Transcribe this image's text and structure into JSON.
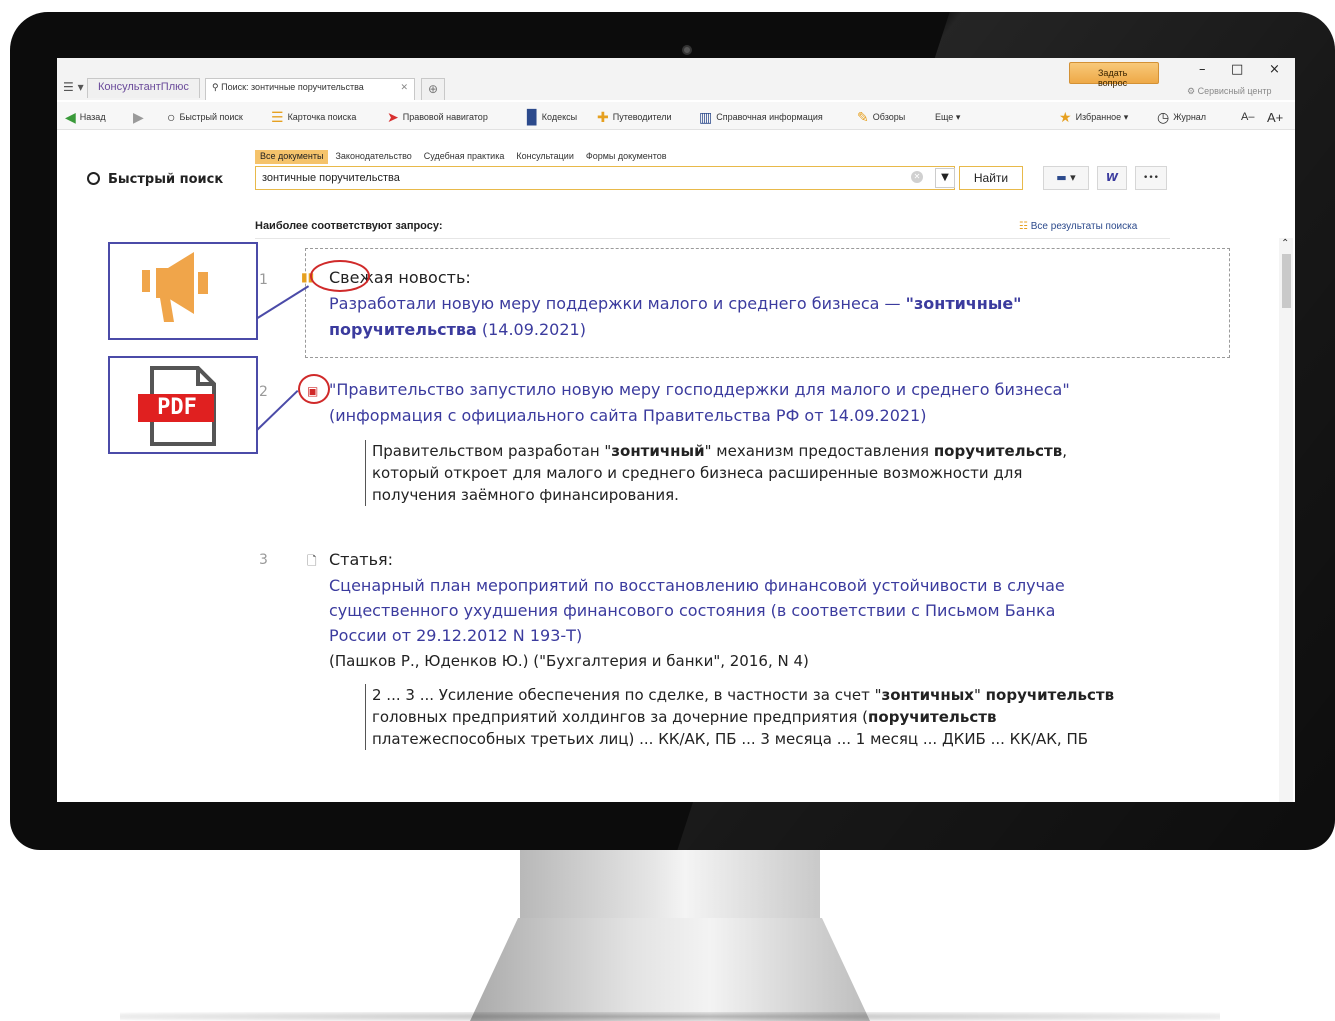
{
  "app": {
    "app_tab": "КонсультантПлюс",
    "search_tab": "Поиск: зонтичные поручительства",
    "ask_button": "Задать вопрос",
    "service_center": "Сервисный центр",
    "window_controls": {
      "minimize": "–",
      "maximize": "□",
      "close": "×"
    }
  },
  "toolbar": {
    "back": "Назад",
    "quick_search": "Быстрый поиск",
    "search_card": "Карточка поиска",
    "legal_navigator": "Правовой навигатор",
    "codes": "Кодексы",
    "guides": "Путеводители",
    "reference": "Справочная информация",
    "reviews": "Обзоры",
    "more": "Еще",
    "favorites": "Избранное",
    "journal": "Журнал",
    "font_small": "A–",
    "font_large": "A+"
  },
  "search": {
    "title": "Быстрый поиск",
    "filters": [
      "Все документы",
      "Законодательство",
      "Судебная практика",
      "Консультации",
      "Формы документов"
    ],
    "active_filter": 0,
    "query": "зонтичные поручительства",
    "find_button": "Найти",
    "word_button": "W",
    "more_button": "•••"
  },
  "results": {
    "header": "Наиболее соответствуют запросу:",
    "all_results": "Все результаты поиска",
    "items": [
      {
        "num": "1",
        "label": "Свежая новость:",
        "link_a": "Разработали новую меру поддержки малого и среднего бизнеса — ",
        "link_b": "\"зонтичные\"",
        "link_c": "поручительства",
        "link_d": " (14.09.2021)"
      },
      {
        "num": "2",
        "title_line1": "\"Правительство запустило новую меру господдержки для малого и среднего бизнеса\"",
        "title_line2": "(информация с официального сайта Правительства РФ от 14.09.2021)",
        "snippet_1a": "Правительством разработан \"",
        "snippet_1b": "зонтичный",
        "snippet_1c": "\" механизм предоставления ",
        "snippet_1d": "поручительств",
        "snippet_1e": ",",
        "snippet_2": "который откроет для малого и среднего бизнеса расширенные возможности для",
        "snippet_3": "получения заёмного финансирования."
      },
      {
        "num": "3",
        "label": "Статья:",
        "title_line1": "Сценарный план мероприятий по восстановлению финансовой устойчивости в случае",
        "title_line2": "существенного ухудшения финансового состояния (в соответствии с Письмом Банка",
        "title_line3": "России от 29.12.2012 N 193-Т)",
        "meta": "(Пашков Р., Юденков Ю.) (\"Бухгалтерия и банки\", 2016, N 4)",
        "snippet_1a": "2 ... 3 ... Усиление обеспечения по сделке, в частности за счет \"",
        "snippet_1b": "зонтичных",
        "snippet_1c": "\" ",
        "snippet_1d": "поручительств",
        "snippet_2a": "головных предприятий холдингов за дочерние предприятия (",
        "snippet_2b": "поручительств",
        "snippet_3": "платежеспособных третьих лиц) ... КК/АК, ПБ ... 3 месяца ... 1 месяц ... ДКИБ ... КК/АК, ПБ"
      }
    ]
  },
  "callouts": {
    "news_icon": "megaphone-icon",
    "pdf_icon": "pdf-icon",
    "pdf_text": "PDF",
    "accent": "#4b4ba8",
    "icon_color": "#f0a54a",
    "pdf_color": "#e02020"
  }
}
